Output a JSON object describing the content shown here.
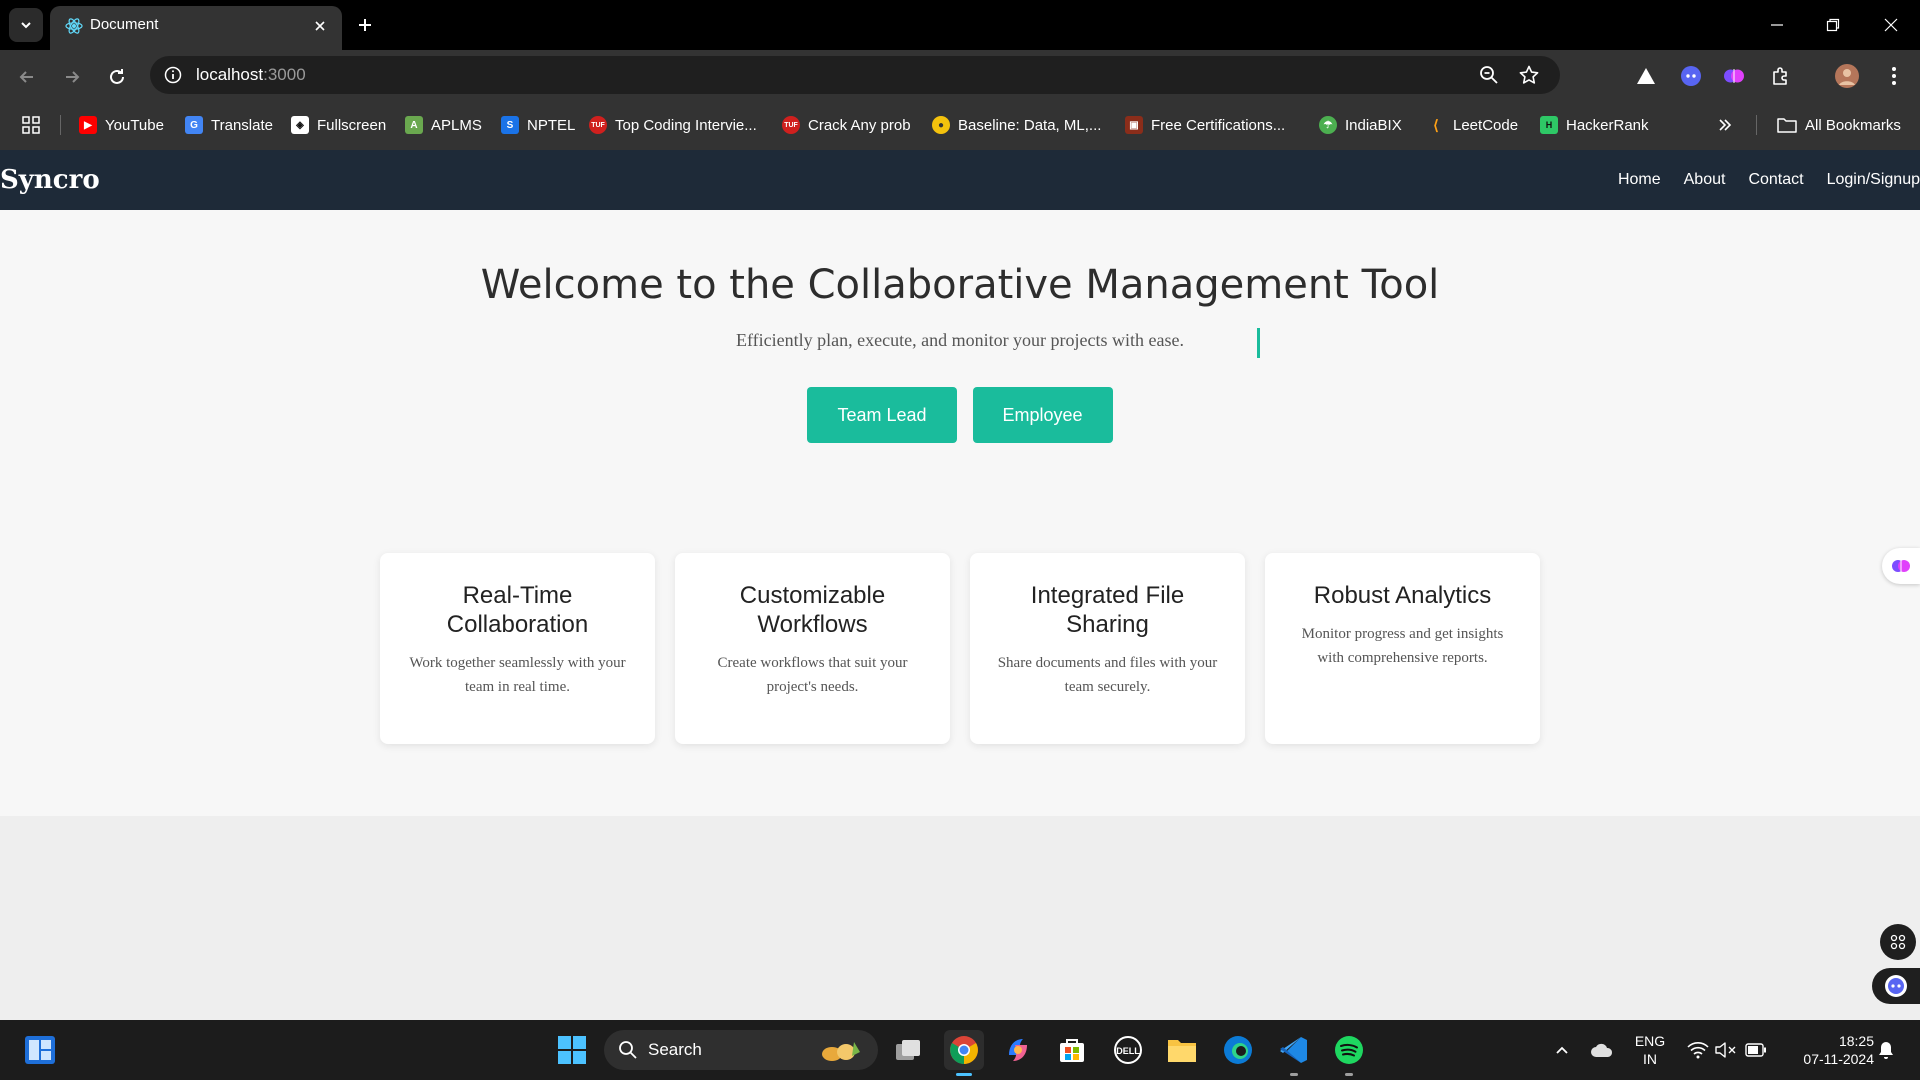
{
  "browser": {
    "tab": {
      "title": "Document"
    },
    "omnibox": {
      "host": "localhost",
      "port": ":3000"
    },
    "bookmarks": [
      {
        "label": "YouTube",
        "icon": "youtube-icon",
        "color": "#ff0000"
      },
      {
        "label": "Translate",
        "icon": "translate-icon",
        "color": "#4285f4"
      },
      {
        "label": "Fullscreen",
        "icon": "fullscreen-icon",
        "color": "#ffffff"
      },
      {
        "label": "APLMS",
        "icon": "aplms-icon",
        "color": "#6aa84f"
      },
      {
        "label": "NPTEL",
        "icon": "nptel-icon",
        "color": "#1a73e8"
      },
      {
        "label": "Top Coding Intervie...",
        "icon": "tuf-icon",
        "color": "#d0201e"
      },
      {
        "label": "Crack Any prob",
        "icon": "tuf-icon",
        "color": "#d0201e"
      },
      {
        "label": "Baseline: Data, ML,...",
        "icon": "baseline-icon",
        "color": "#f4c20d"
      },
      {
        "label": "Free Certifications...",
        "icon": "certifications-icon",
        "color": "#8b2d1a"
      },
      {
        "label": "IndiaBIX",
        "icon": "indiabix-icon",
        "color": "#4caf50"
      },
      {
        "label": "LeetCode",
        "icon": "leetcode-icon",
        "color": "#ffa116"
      },
      {
        "label": "HackerRank",
        "icon": "hackerrank-icon",
        "color": "#2ec866"
      }
    ],
    "all_bookmarks": "All Bookmarks"
  },
  "site": {
    "brand": "Syncro",
    "nav": [
      "Home",
      "About",
      "Contact",
      "Login/Signup"
    ],
    "hero": {
      "title": "Welcome to the Collaborative Management Tool",
      "subtitle": "Efficiently plan, execute, and monitor your projects with ease.",
      "buttons": [
        "Team Lead",
        "Employee"
      ]
    },
    "features": [
      {
        "title": "Real-Time Collaboration",
        "text": "Work together seamlessly with your team in real time."
      },
      {
        "title": "Customizable Workflows",
        "text": "Create workflows that suit your project's needs."
      },
      {
        "title": "Integrated File Sharing",
        "text": "Share documents and files with your team securely."
      },
      {
        "title": "Robust Analytics",
        "text": "Monitor progress and get insights with comprehensive reports."
      }
    ],
    "colors": {
      "accent": "#1abc9c",
      "nav_bg": "#1e2a38"
    }
  },
  "taskbar": {
    "search_label": "Search",
    "language": {
      "line1": "ENG",
      "line2": "IN"
    },
    "clock": {
      "time": "18:25",
      "date": "07-11-2024"
    }
  }
}
